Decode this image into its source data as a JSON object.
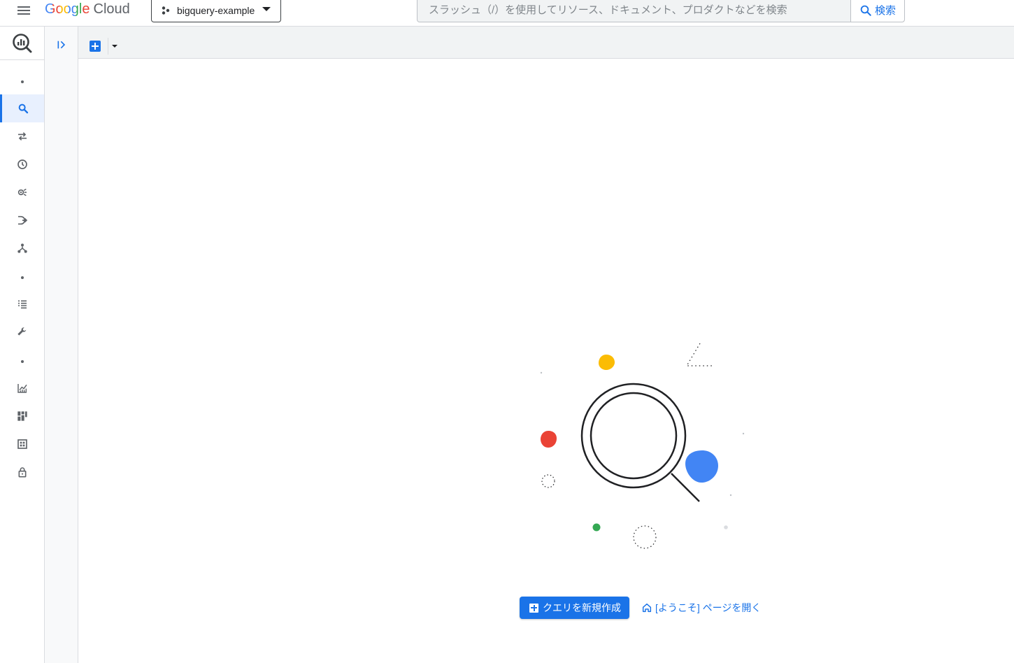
{
  "header": {
    "logo_google": "Google",
    "logo_cloud": "Cloud",
    "project_name": "bigquery-example",
    "search_placeholder": "スラッシュ（/）を使用してリソース、ドキュメント、プロダクトなどを検索",
    "search_button": "検索"
  },
  "rail": {
    "items": [
      {
        "name": "search-icon",
        "active": true
      },
      {
        "name": "transfers-icon"
      },
      {
        "name": "scheduled-queries-icon"
      },
      {
        "name": "analytics-hub-icon"
      },
      {
        "name": "dataflow-icon"
      },
      {
        "name": "dataplex-icon"
      },
      {
        "name": "jobs-list-icon"
      },
      {
        "name": "wrench-icon"
      },
      {
        "name": "monitoring-icon"
      },
      {
        "name": "dashboard-icon"
      },
      {
        "name": "capacity-icon"
      },
      {
        "name": "lock-icon"
      }
    ]
  },
  "empty_state": {
    "new_query_button": "クエリを新規作成",
    "open_welcome_link": "[ようこそ] ページを開く"
  },
  "colors": {
    "accent": "#1a73e8",
    "google_blue": "#4285f4",
    "google_red": "#ea4335",
    "google_yellow": "#fbbc04",
    "google_green": "#34a853"
  }
}
